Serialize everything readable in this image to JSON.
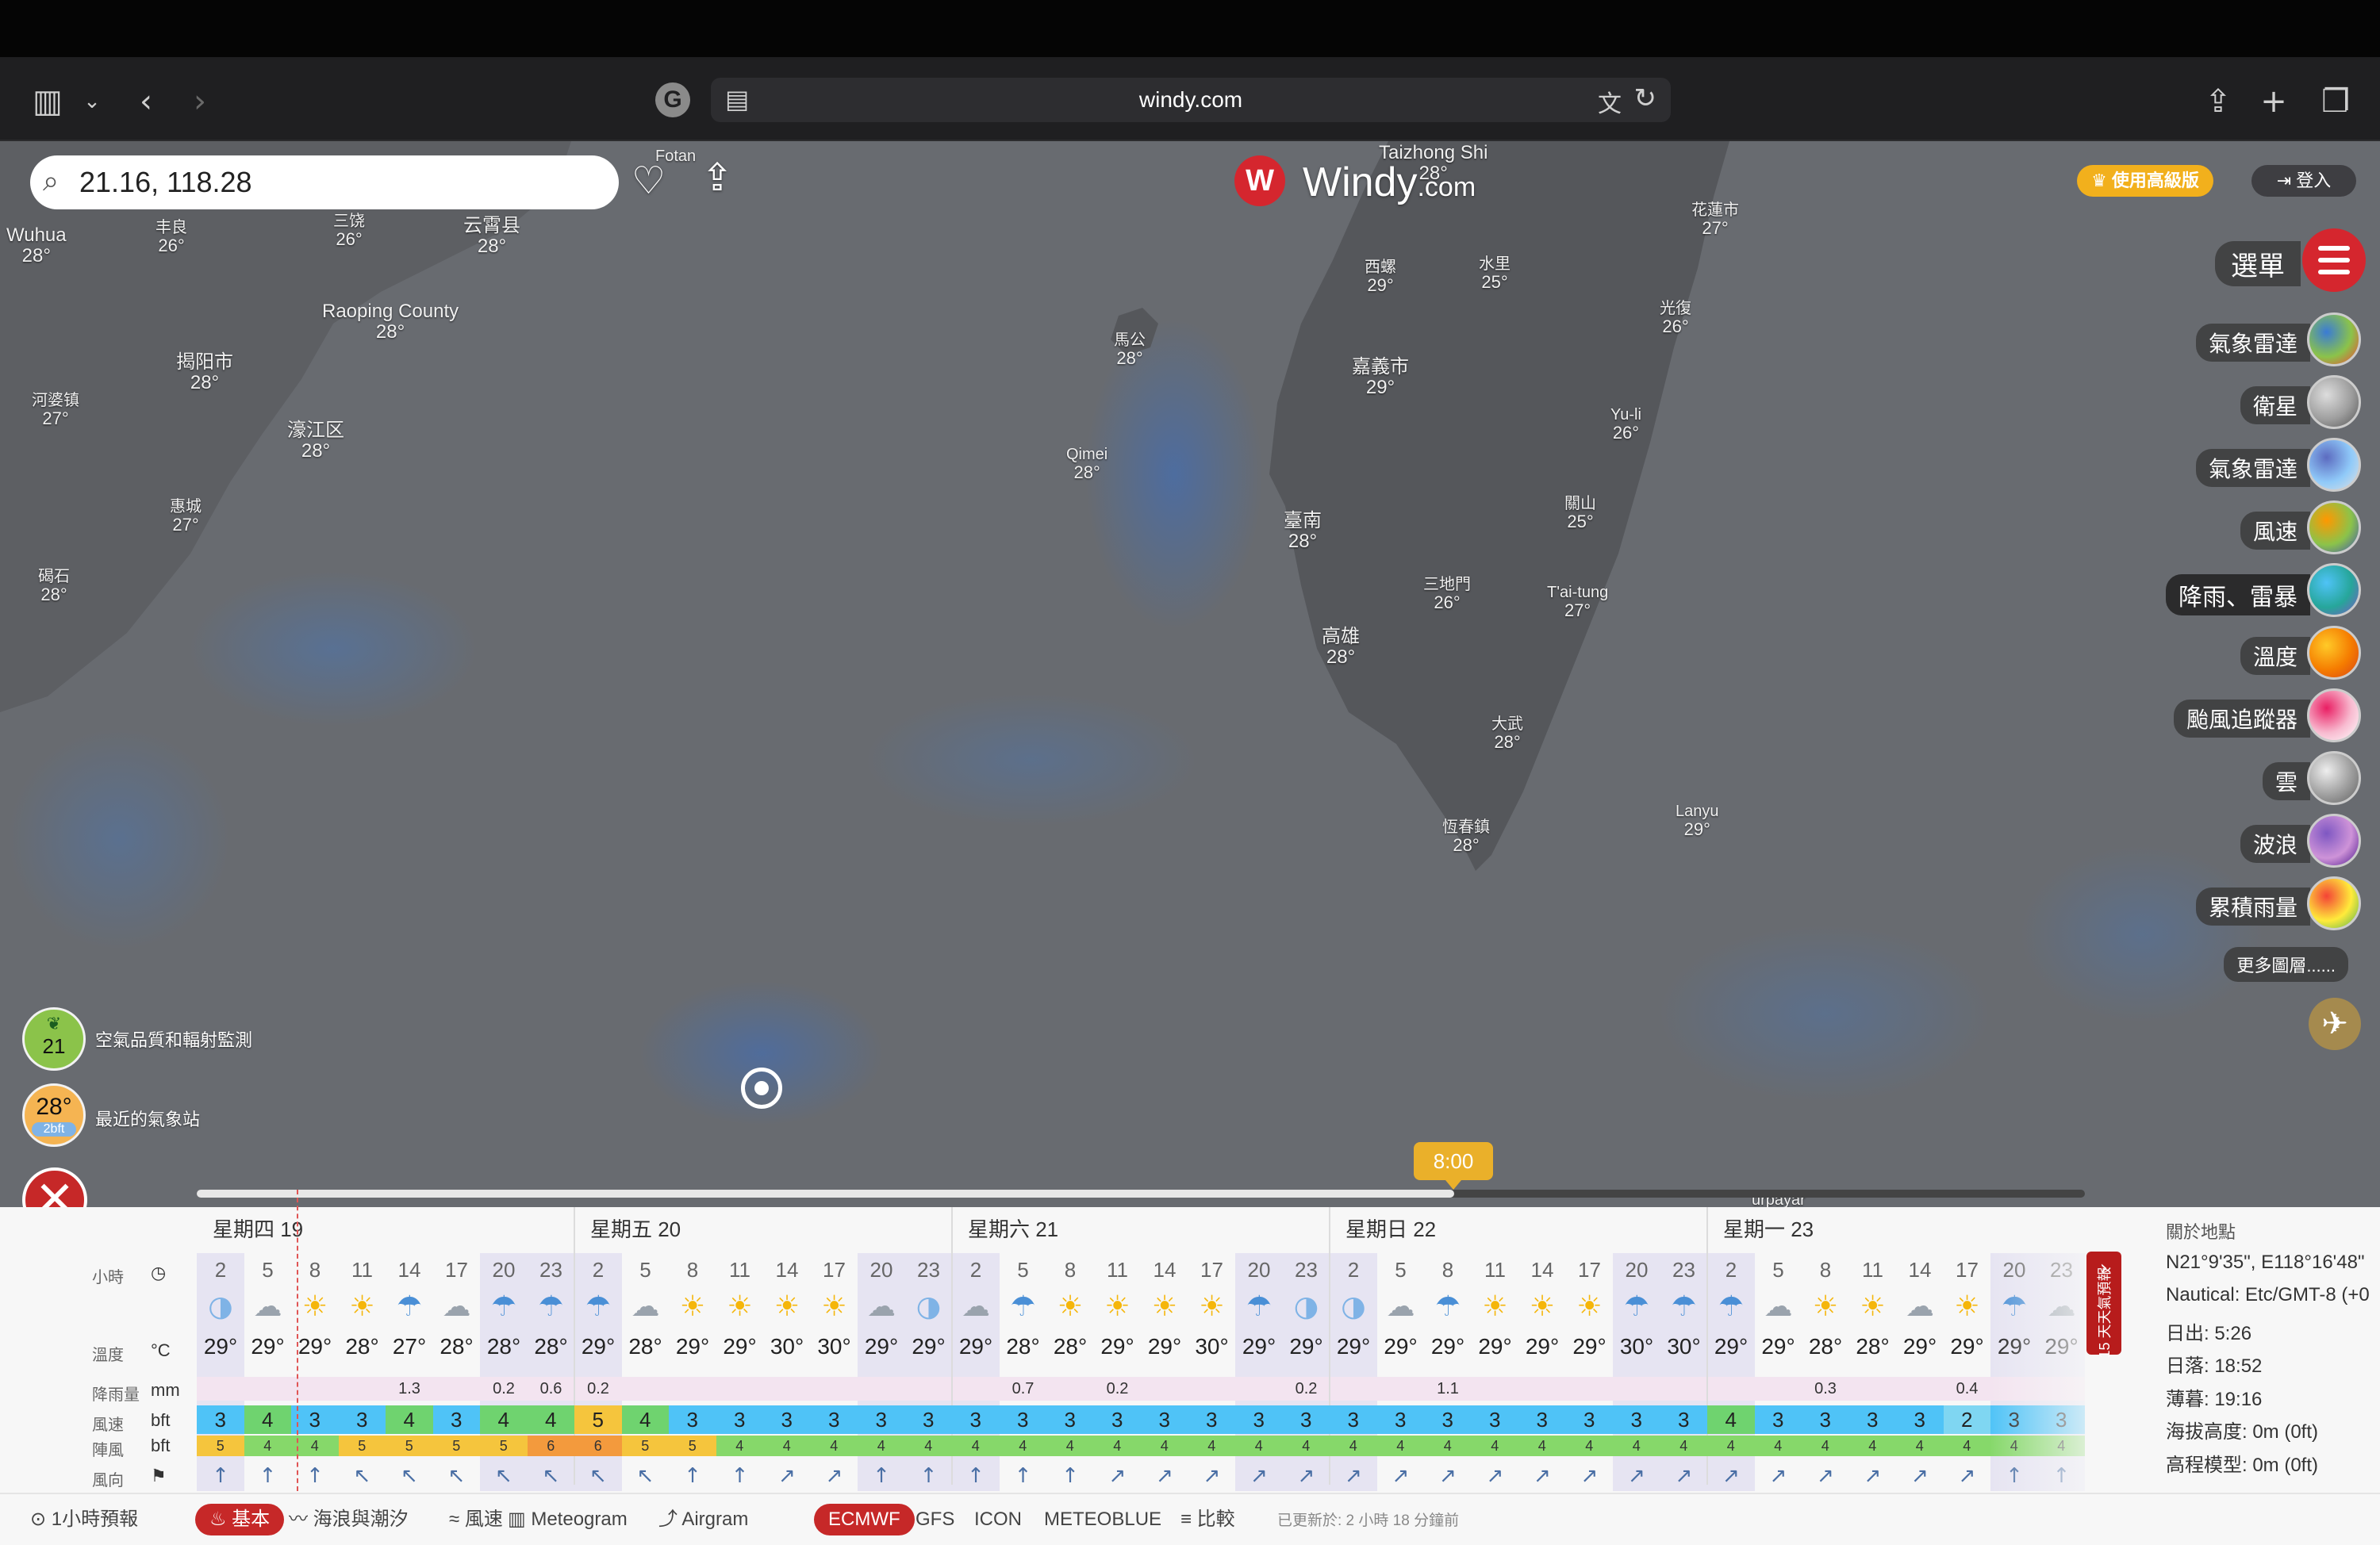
{
  "browser": {
    "url": "windy.com",
    "icons": [
      "sidebar-icon",
      "chevron-down-icon",
      "back-icon",
      "forward-icon",
      "grammarly-icon",
      "reader-icon",
      "translate-icon",
      "reload-icon",
      "share-icon",
      "new-tab-icon",
      "tabs-icon"
    ],
    "grammarly_letter": "G"
  },
  "search": {
    "value": "21.16, 118.28"
  },
  "brand": {
    "name": "Windy",
    "suffix": ".com"
  },
  "header_buttons": {
    "premium": "♛ 使用高級版",
    "login": "⇥ 登入"
  },
  "menu": {
    "label": "選單"
  },
  "layers": [
    {
      "label": "氣象雷達",
      "colors": [
        "#3a7bd5",
        "#8bc34a",
        "#f44336"
      ]
    },
    {
      "label": "衛星",
      "colors": [
        "#dddddd",
        "#9e9e9e",
        "#555555"
      ]
    },
    {
      "label": "氣象雷達",
      "colors": [
        "#5c6bc0",
        "#90caf9",
        "#e0e0e0"
      ]
    },
    {
      "label": "風速",
      "colors": [
        "#ff9800",
        "#8bc34a",
        "#3f51b5"
      ]
    },
    {
      "label": "降雨、雷暴",
      "colors": [
        "#4fc3f7",
        "#26a69a",
        "#7e57c2"
      ],
      "active": true
    },
    {
      "label": "溫度",
      "colors": [
        "#ffca28",
        "#f57c00",
        "#d84315"
      ]
    },
    {
      "label": "颱風追蹤器",
      "colors": [
        "#e91e63",
        "#f8bbd0",
        "#ffffff"
      ]
    },
    {
      "label": "雲",
      "colors": [
        "#eeeeee",
        "#9e9e9e",
        "#616161"
      ]
    },
    {
      "label": "波浪",
      "colors": [
        "#7e57c2",
        "#ce93d8",
        "#4a148c"
      ]
    },
    {
      "label": "累積雨量",
      "colors": [
        "#f44336",
        "#ffeb3b",
        "#4caf50"
      ]
    }
  ],
  "more_layers": "更多圖層......",
  "air_quality": {
    "value": "21",
    "label": "空氣品質和輻射監測"
  },
  "weather_station": {
    "temp": "28°",
    "sub": "2bft",
    "label": "最近的氣象站"
  },
  "time_bubble": "8:00",
  "timeline_progress": 0.666,
  "cities": [
    {
      "name": "Fotan",
      "temp": "",
      "big": false
    },
    {
      "name": "Wuhua",
      "temp": "28°",
      "big": true
    },
    {
      "name": "丰良",
      "temp": "26°",
      "big": false
    },
    {
      "name": "三饶",
      "temp": "26°",
      "big": false
    },
    {
      "name": "云霄县",
      "temp": "28°",
      "big": true
    },
    {
      "name": "Raoping County",
      "temp": "28°",
      "big": true
    },
    {
      "name": "揭阳市",
      "temp": "28°",
      "big": true
    },
    {
      "name": "河婆镇",
      "temp": "27°",
      "big": false
    },
    {
      "name": "濠江区",
      "temp": "28°",
      "big": true
    },
    {
      "name": "惠城",
      "temp": "27°",
      "big": false
    },
    {
      "name": "碣石",
      "temp": "28°",
      "big": false
    },
    {
      "name": "Taizhong Shi",
      "temp": "28°",
      "big": true
    },
    {
      "name": "花蓮市",
      "temp": "27°",
      "big": false
    },
    {
      "name": "西螺",
      "temp": "29°",
      "big": false
    },
    {
      "name": "水里",
      "temp": "25°",
      "big": false
    },
    {
      "name": "光復",
      "temp": "26°",
      "big": false
    },
    {
      "name": "馬公",
      "temp": "28°",
      "big": false
    },
    {
      "name": "嘉義市",
      "temp": "29°",
      "big": true
    },
    {
      "name": "Yu-li",
      "temp": "26°",
      "big": false
    },
    {
      "name": "Qimei",
      "temp": "28°",
      "big": false
    },
    {
      "name": "關山",
      "temp": "25°",
      "big": false
    },
    {
      "name": "臺南",
      "temp": "28°",
      "big": true
    },
    {
      "name": "三地門",
      "temp": "26°",
      "big": false
    },
    {
      "name": "T'ai-tung",
      "temp": "27°",
      "big": false
    },
    {
      "name": "高雄",
      "temp": "28°",
      "big": true
    },
    {
      "name": "大武",
      "temp": "28°",
      "big": false
    },
    {
      "name": "Lanyu",
      "temp": "29°",
      "big": false
    },
    {
      "name": "恆春鎮",
      "temp": "28°",
      "big": false
    },
    {
      "name": "urpayar",
      "temp": "",
      "big": false
    }
  ],
  "forecast": {
    "days": [
      "星期四 19",
      "星期五 20",
      "星期六 21",
      "星期日 22",
      "星期一 23"
    ],
    "row_labels": {
      "hours": "小時",
      "temp": "溫度",
      "rain": "降雨量",
      "wind": "風速",
      "gust": "陣風",
      "dir": "風向"
    },
    "units": {
      "hours": "◷",
      "temp": "°C",
      "rain": "mm",
      "wind": "bft",
      "gust": "bft",
      "dir": "⚑"
    },
    "hours": [
      "2",
      "5",
      "8",
      "11",
      "14",
      "17",
      "20",
      "23",
      "2",
      "5",
      "8",
      "11",
      "14",
      "17",
      "20",
      "23",
      "2",
      "5",
      "8",
      "11",
      "14",
      "17",
      "20",
      "23",
      "2",
      "5",
      "8",
      "11",
      "14",
      "17",
      "20",
      "23",
      "2",
      "5",
      "8",
      "11",
      "14",
      "17",
      "20",
      "23"
    ],
    "icons": [
      "◑",
      "☁",
      "☀",
      "☀",
      "☂",
      "☁",
      "☂",
      "☂",
      "☂",
      "☁",
      "☀",
      "☀",
      "☀",
      "☀",
      "☁",
      "◑",
      "☁",
      "☂",
      "☀",
      "☀",
      "☀",
      "☀",
      "☂",
      "◑",
      "◑",
      "☁",
      "☂",
      "☀",
      "☀",
      "☀",
      "☂",
      "☂",
      "☂",
      "☁",
      "☀",
      "☀",
      "☁",
      "☀",
      "☂",
      "☁"
    ],
    "temps": [
      "29°",
      "29°",
      "29°",
      "28°",
      "27°",
      "28°",
      "28°",
      "28°",
      "29°",
      "28°",
      "29°",
      "29°",
      "30°",
      "30°",
      "29°",
      "29°",
      "29°",
      "28°",
      "28°",
      "29°",
      "29°",
      "30°",
      "29°",
      "29°",
      "29°",
      "29°",
      "29°",
      "29°",
      "29°",
      "29°",
      "30°",
      "30°",
      "29°",
      "29°",
      "28°",
      "28°",
      "29°",
      "29°",
      "29°",
      "29°"
    ],
    "rain": [
      "",
      "",
      "",
      "",
      "1.3",
      "",
      "0.2",
      "0.6",
      "0.2",
      "",
      "",
      "",
      "",
      "",
      "",
      "",
      "",
      "0.7",
      "",
      "0.2",
      "",
      "",
      "",
      "0.2",
      "",
      "",
      "1.1",
      "",
      "",
      "",
      "",
      "",
      "",
      "",
      "0.3",
      "",
      "",
      "0.4",
      "",
      ""
    ],
    "wind": [
      "3",
      "4",
      "3",
      "3",
      "4",
      "3",
      "4",
      "4",
      "5",
      "4",
      "3",
      "3",
      "3",
      "3",
      "3",
      "3",
      "3",
      "3",
      "3",
      "3",
      "3",
      "3",
      "3",
      "3",
      "3",
      "3",
      "3",
      "3",
      "3",
      "3",
      "3",
      "3",
      "4",
      "3",
      "3",
      "3",
      "3",
      "2",
      "3",
      "3"
    ],
    "gust": [
      "5",
      "4",
      "4",
      "5",
      "5",
      "5",
      "5",
      "6",
      "6",
      "5",
      "5",
      "4",
      "4",
      "4",
      "4",
      "4",
      "4",
      "4",
      "4",
      "4",
      "4",
      "4",
      "4",
      "4",
      "4",
      "4",
      "4",
      "4",
      "4",
      "4",
      "4",
      "4",
      "4",
      "4",
      "4",
      "4",
      "4",
      "4",
      "4",
      "4"
    ],
    "dir": [
      "↑",
      "↑",
      "↑",
      "↖",
      "↖",
      "↖",
      "↖",
      "↖",
      "↖",
      "↖",
      "↑",
      "↑",
      "↗",
      "↗",
      "↑",
      "↑",
      "↑",
      "↑",
      "↑",
      "↗",
      "↗",
      "↗",
      "↗",
      "↗",
      "↗",
      "↗",
      "↗",
      "↗",
      "↗",
      "↗",
      "↗",
      "↗",
      "↗",
      "↗",
      "↗",
      "↗",
      "↗",
      "↗",
      "↑",
      "↑"
    ]
  },
  "side_tab": {
    "chevron": "›",
    "label": "15 天天氣預報"
  },
  "location_info": [
    "關於地點",
    "N21°9'35\", E118°16'48\"",
    "Nautical: Etc/GMT-8 (+0",
    "日出: 5:26",
    "日落: 18:52",
    "薄暮: 19:16",
    "海拔高度: 0m (0ft)",
    "高程模型: 0m (0ft)"
  ],
  "bottom_tabs": [
    {
      "label": "⊙ 1小時預報",
      "active": false
    },
    {
      "label": "♨ 基本",
      "active": true
    },
    {
      "label": "〰 海浪與潮汐",
      "active": false
    },
    {
      "label": "≈ 風速",
      "active": false
    },
    {
      "label": "▥ Meteogram",
      "active": false
    },
    {
      "label": "⤴ Airgram",
      "active": false
    },
    {
      "label": "ECMWF",
      "active": true
    },
    {
      "label": "GFS",
      "active": false
    },
    {
      "label": "ICON",
      "active": false
    },
    {
      "label": "METEOBLUE",
      "active": false
    },
    {
      "label": "≡ 比較",
      "active": false
    }
  ],
  "updated": "已更新於: 2 小時 18 分鐘前"
}
